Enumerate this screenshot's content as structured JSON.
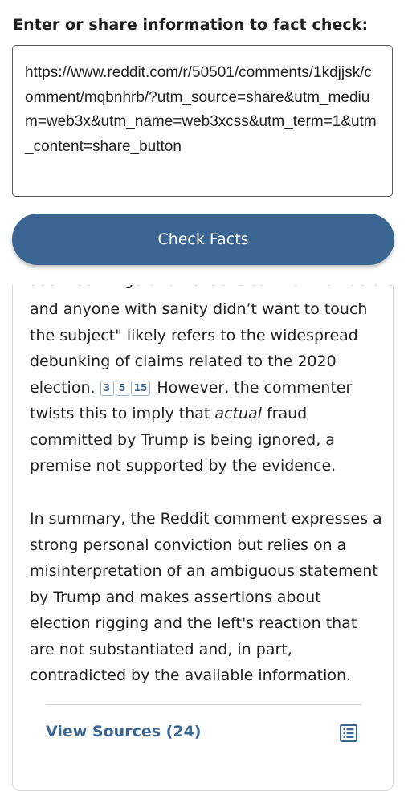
{
  "prompt": {
    "label": "Enter or share information to fact check:"
  },
  "input": {
    "value": "https://www.reddit.com/r/50501/comments/1kdjjsk/comment/mqbnhrb/?utm_source=share&utm_medium=web3x&utm_name=web3xcss&utm_term=1&utm_content=share_button"
  },
  "check_button": {
    "label": "Check Facts"
  },
  "result": {
    "clipped_line": "seem so fringe and nonsensical that Democrats",
    "p1_before_citations": "and anyone with sanity didn’t want to touch the subject\" likely refers to the widespread debunking of claims related to the 2020 election.",
    "citations": [
      "3",
      "5",
      "15"
    ],
    "p1_after_citations_a": " However, the commenter twists this to imply that ",
    "p1_emphasis": "actual",
    "p1_after_citations_b": " fraud committed by Trump is being ignored, a premise not supported by the evidence.",
    "p2": "In summary, the Reddit comment expresses a strong personal conviction but relies on a misinterpretation of an ambiguous statement by Trump and makes assertions about election rigging and the left's reaction that are not substantiated and, in part, contradicted by the available information."
  },
  "sources": {
    "label": "View Sources (24)",
    "icon": "list-icon"
  },
  "colors": {
    "accent": "#3b6593",
    "citation_border": "#9db3cc"
  }
}
